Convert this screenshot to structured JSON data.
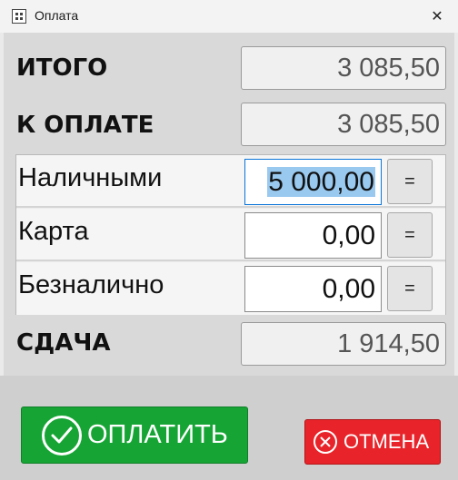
{
  "window": {
    "title": "Оплата",
    "close_glyph": "✕",
    "icon": "window-app-icon"
  },
  "totals": {
    "itogo_label": "ИТОГО",
    "itogo_value": "3 085,50",
    "k_oplate_label": "К ОПЛАТЕ",
    "k_oplate_value": "3 085,50",
    "sdacha_label": "СДАЧА",
    "sdacha_value": "1 914,50"
  },
  "payments": [
    {
      "label": "Наличными",
      "value": "5 000,00",
      "selected": true,
      "eq": "="
    },
    {
      "label": "Карта",
      "value": "0,00",
      "selected": false,
      "eq": "="
    },
    {
      "label": "Безналично",
      "value": "0,00",
      "selected": false,
      "eq": "="
    }
  ],
  "actions": {
    "pay_label": "ОПЛАТИТЬ",
    "pay_icon": "check-circle-icon",
    "cancel_label": "ОТМЕНА",
    "cancel_icon": "x-circle-icon"
  },
  "colors": {
    "pay_green": "#16a535",
    "cancel_red": "#e8242a",
    "selection_blue": "#99c9ef",
    "focus_border": "#0a74d9"
  }
}
